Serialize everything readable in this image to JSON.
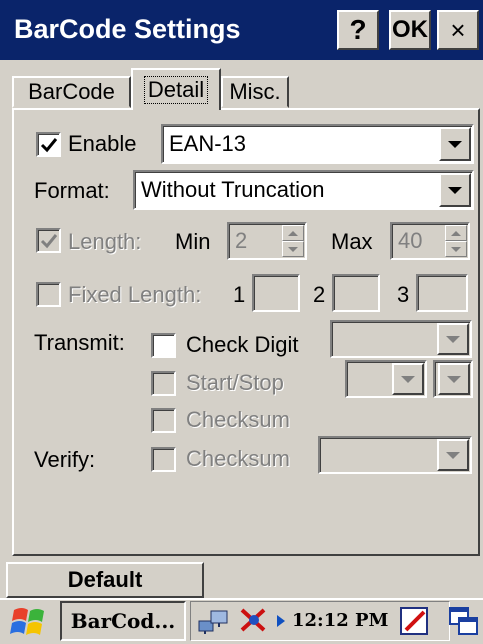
{
  "window": {
    "title": "BarCode Settings",
    "help_label": "?",
    "ok_label": "OK",
    "close_label": "×"
  },
  "tabs": [
    {
      "label": "BarCode",
      "active": false
    },
    {
      "label": "Detail",
      "active": true
    },
    {
      "label": "Misc.",
      "active": false
    }
  ],
  "enable": {
    "label": "Enable",
    "checked": true,
    "symbology": "EAN-13"
  },
  "format": {
    "label": "Format:",
    "value": "Without Truncation"
  },
  "length": {
    "label": "Length:",
    "checked": true,
    "enabled": false,
    "min_label": "Min",
    "min_value": "2",
    "max_label": "Max",
    "max_value": "40"
  },
  "fixed_length": {
    "label": "Fixed Length:",
    "checked": false,
    "enabled": false,
    "slots": [
      {
        "label": "1",
        "value": ""
      },
      {
        "label": "2",
        "value": ""
      },
      {
        "label": "3",
        "value": ""
      }
    ]
  },
  "transmit": {
    "label": "Transmit:",
    "check_digit": {
      "label": "Check Digit",
      "checked": false,
      "enabled": true,
      "value": ""
    },
    "start_stop": {
      "label": "Start/Stop",
      "checked": false,
      "enabled": false
    },
    "checksum": {
      "label": "Checksum",
      "checked": false,
      "enabled": false
    }
  },
  "verify": {
    "label": "Verify:",
    "checksum": {
      "label": "Checksum",
      "checked": false,
      "enabled": false
    }
  },
  "buttons": {
    "default_label": "Default"
  },
  "taskbar": {
    "task_label": "BarCod...",
    "clock": "12:12 PM"
  },
  "colors": {
    "titlebar": "#0a246a",
    "face": "#d4d0c8",
    "disabled_text": "#808080"
  }
}
